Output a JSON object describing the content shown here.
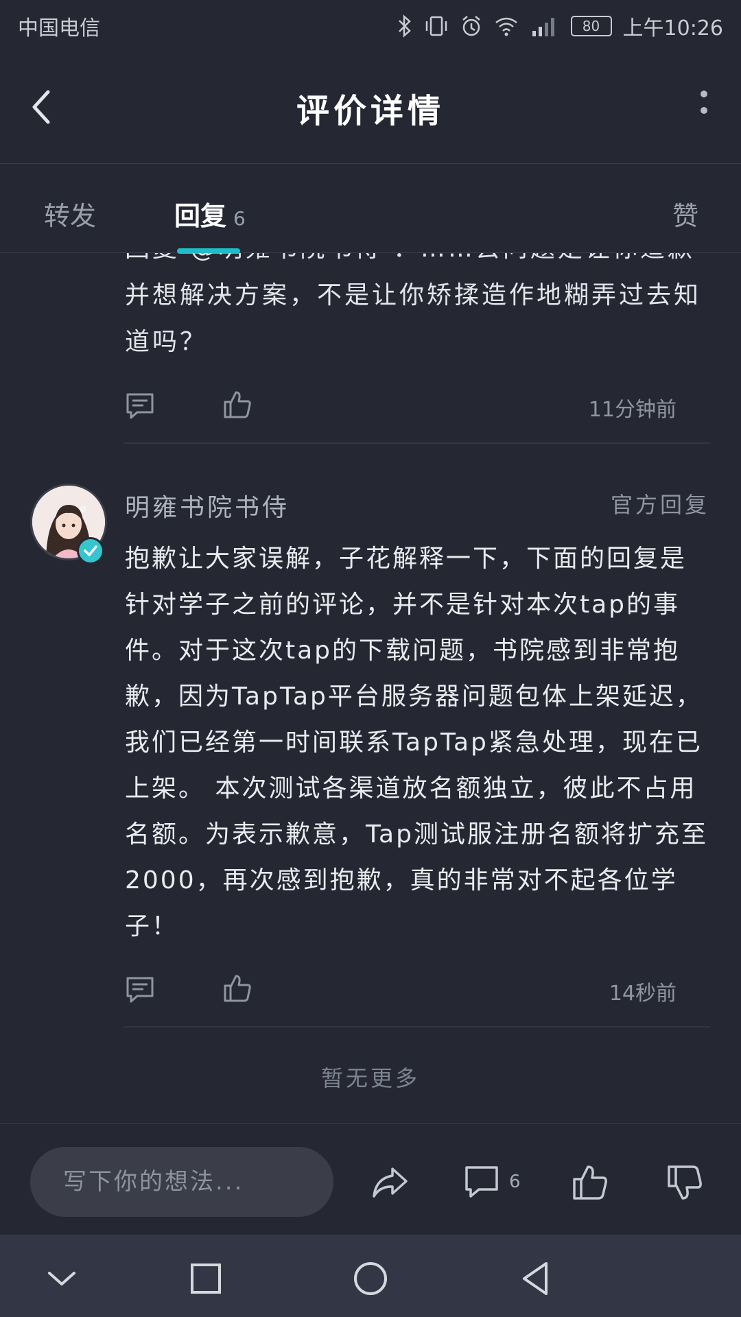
{
  "status": {
    "carrier": "中国电信",
    "battery": "80",
    "time": "上午10:26"
  },
  "header": {
    "title": "评价详情"
  },
  "tabs": [
    {
      "label": "转发",
      "count": ""
    },
    {
      "label": "回复",
      "count": "6"
    },
    {
      "label": "赞",
      "count": ""
    }
  ],
  "prev_reply": {
    "text": "回复 @明雍书院书侍 ：……去问题是让你道歉并想解决方案，不是让你矫揉造作地糊弄过去知道吗？",
    "time": "11分钟前"
  },
  "reply": {
    "author": "明雍书院书侍",
    "badge": "官方回复",
    "text": "抱歉让大家误解，子花解释一下，下面的回复是针对学子之前的评论，并不是针对本次tap的事件。对于这次tap的下载问题，书院感到非常抱歉，因为TapTap平台服务器问题包体上架延迟，我们已经第一时间联系TapTap紧急处理，现在已上架。 本次测试各渠道放名额独立，彼此不占用名额。为表示歉意，Tap测试服注册名额将扩充至2000，再次感到抱歉，真的非常对不起各位学子！",
    "time": "14秒前"
  },
  "footer_note": "暂无更多",
  "bottom_bar": {
    "placeholder": "写下你的想法...",
    "comment_count": "6"
  },
  "colors": {
    "background": "#252833",
    "accent": "#1ebdc9",
    "navbar": "#333745"
  }
}
